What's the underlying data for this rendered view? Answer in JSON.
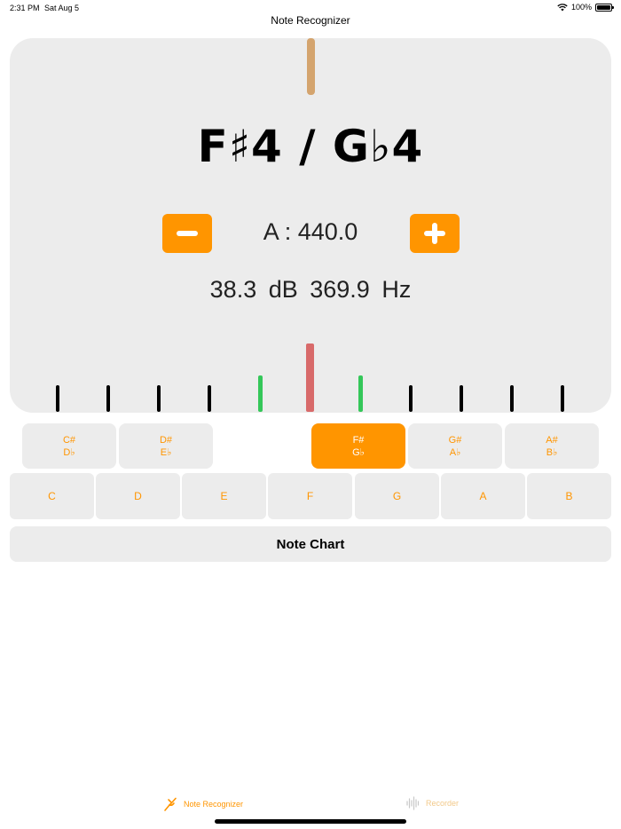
{
  "status_bar": {
    "time": "2:31 PM",
    "date": "Sat Aug 5",
    "battery": "100%"
  },
  "nav": {
    "title": "Note Recognizer"
  },
  "tuner": {
    "note": "F♯4 / G♭4",
    "reference": "A : 440.0",
    "level_db": "38.3 dB",
    "frequency_hz": "369.9 Hz",
    "colors": {
      "accent": "#ff9500",
      "center_tick": "#d86a6a",
      "near_tick": "#34c759",
      "tick": "#000000",
      "top_indicator": "#d4a46e"
    }
  },
  "sharp_keys": [
    {
      "sharp": "C#",
      "flat": "D♭"
    },
    {
      "sharp": "D#",
      "flat": "E♭"
    },
    {
      "sharp": "F#",
      "flat": "G♭",
      "selected": true
    },
    {
      "sharp": "G#",
      "flat": "A♭"
    },
    {
      "sharp": "A#",
      "flat": "B♭"
    }
  ],
  "natural_keys": [
    "C",
    "D",
    "E",
    "F",
    "G",
    "A",
    "B"
  ],
  "note_chart": {
    "label": "Note Chart"
  },
  "tabbar": {
    "tab1": "Note Recognizer",
    "tab2": "Recorder"
  }
}
